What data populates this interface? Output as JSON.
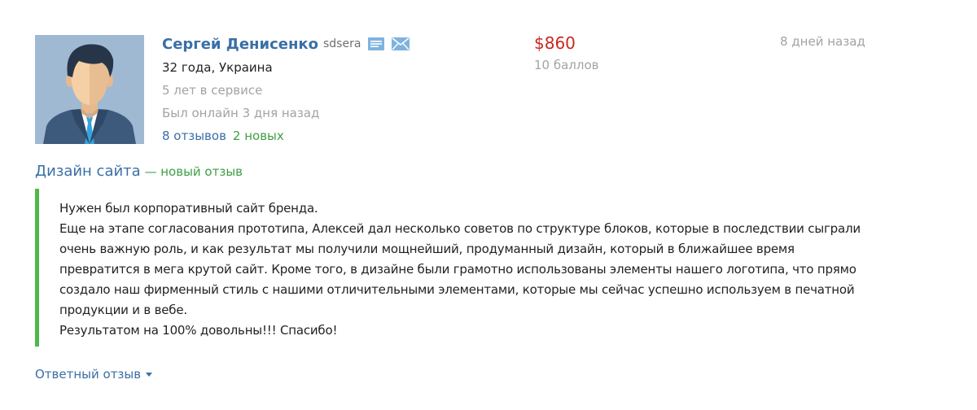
{
  "user": {
    "name": "Сергей Денисенко",
    "login": "sdsera",
    "age_country": "32 года, Украина",
    "years_on_service": "5 лет в сервисе",
    "last_online": "Был онлайн 3 дня назад",
    "reviews": "8 отзывов",
    "new_reviews": "2 новых",
    "avatar_icon": "user-avatar-icon"
  },
  "payment": {
    "amount": "$860",
    "points": "10 баллов"
  },
  "date": "8 дней назад",
  "project": {
    "title": "Дизайн сайта",
    "status": " — новый отзыв"
  },
  "review": {
    "text": "Нужен был корпоративный сайт бренда.\nЕще на этапе согласования прототипа, Алексей дал несколько советов по структуре блоков, которые в последствии сыграли\nочень важную роль, и как результат мы получили мощнейший, продуманный дизайн, который в ближайшее время\nпревратится в мега крутой сайт. Кроме того, в дизайне были грамотно использованы элементы нашего логотипа, что прямо\nсоздало наш фирменный стиль с нашими отличительными элементами, которые мы сейчас успешно используем в печатной\nпродукции и в вебе.\nРезультатом на 100% довольны!!! Спасибо!"
  },
  "reply": {
    "label": "Ответный отзыв"
  },
  "colors": {
    "link": "#3a6fa6",
    "price": "#c8291f",
    "green": "#3f9f45",
    "border": "#4cba4a",
    "muted": "#a3a3a3"
  }
}
